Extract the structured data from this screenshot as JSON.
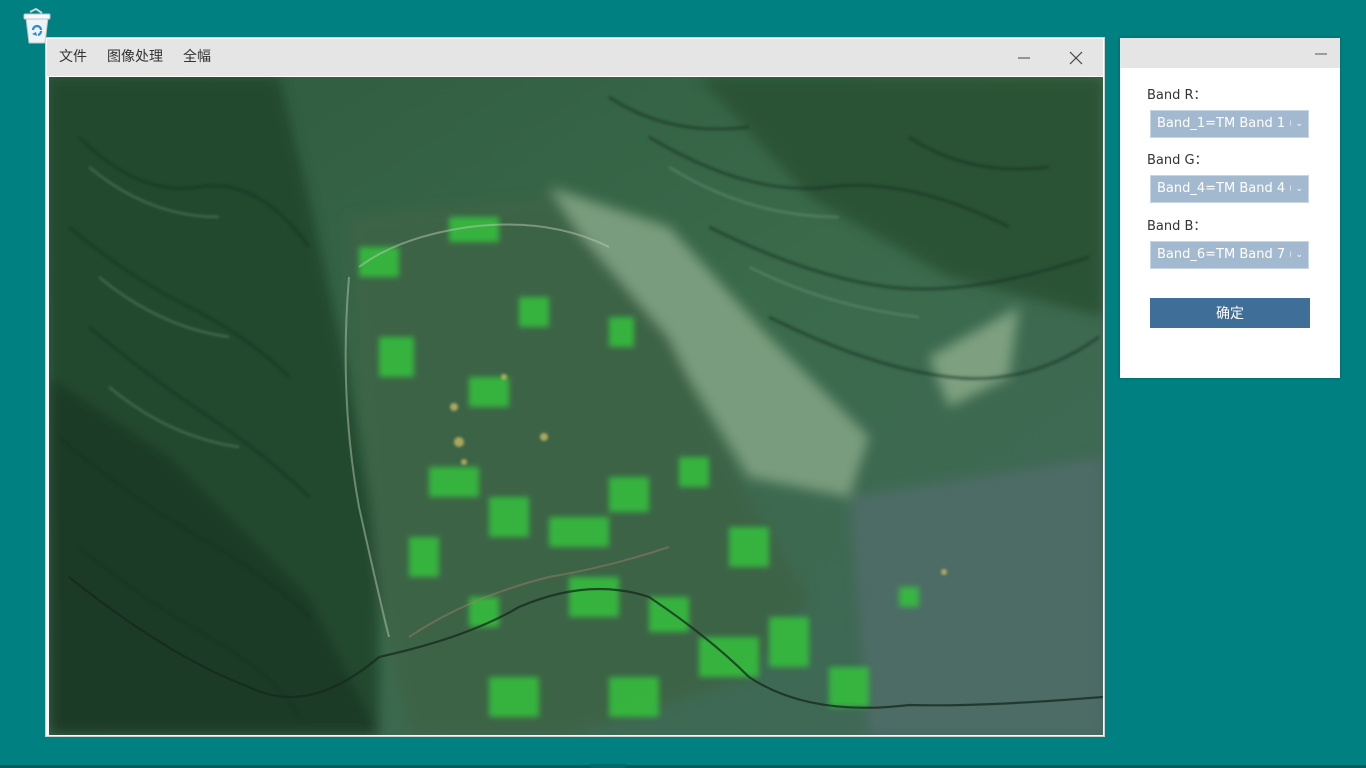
{
  "desktop": {
    "recycle_bin_icon": "recycle-bin-icon"
  },
  "main_window": {
    "menu": [
      "文件",
      "图像处理",
      "全幅"
    ],
    "minimize_icon": "minimize-icon",
    "close_icon": "close-icon",
    "image": "satellite-false-color-composite"
  },
  "band_panel": {
    "minimize_icon": "minimize-icon",
    "band_r": {
      "label": "Band R：",
      "value": "Band_1=TM Band 1 ("
    },
    "band_g": {
      "label": "Band G：",
      "value": "Band_4=TM Band 4 ("
    },
    "band_b": {
      "label": "Band B：",
      "value": "Band_6=TM Band 7 ("
    },
    "ok_label": "确定"
  },
  "colors": {
    "desktop": "#008080",
    "titlebar": "#e5e5e5",
    "select_bg": "#a3b9cf",
    "button": "#3f6e98"
  }
}
